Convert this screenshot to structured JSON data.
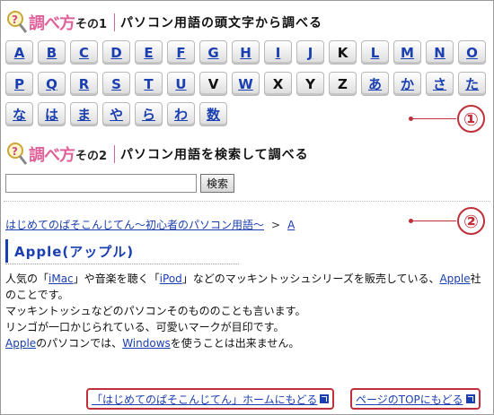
{
  "section1": {
    "title": "調べ方",
    "suffix": "その1",
    "desc": "パソコン用語の頭文字から調べる"
  },
  "section2": {
    "title": "調べ方",
    "suffix": "その2",
    "desc": "パソコン用語を検索して調べる"
  },
  "keys_row1": [
    {
      "label": "A",
      "linked": true
    },
    {
      "label": "B",
      "linked": true
    },
    {
      "label": "C",
      "linked": true
    },
    {
      "label": "D",
      "linked": true
    },
    {
      "label": "E",
      "linked": true
    },
    {
      "label": "F",
      "linked": true
    },
    {
      "label": "G",
      "linked": true
    },
    {
      "label": "H",
      "linked": true
    },
    {
      "label": "I",
      "linked": true
    },
    {
      "label": "J",
      "linked": true
    },
    {
      "label": "K",
      "linked": false
    },
    {
      "label": "L",
      "linked": true
    },
    {
      "label": "M",
      "linked": true
    },
    {
      "label": "N",
      "linked": true
    },
    {
      "label": "O",
      "linked": true
    }
  ],
  "keys_row2": [
    {
      "label": "P",
      "linked": true
    },
    {
      "label": "Q",
      "linked": true
    },
    {
      "label": "R",
      "linked": true
    },
    {
      "label": "S",
      "linked": true
    },
    {
      "label": "T",
      "linked": true
    },
    {
      "label": "U",
      "linked": true
    },
    {
      "label": "V",
      "linked": false
    },
    {
      "label": "W",
      "linked": true
    },
    {
      "label": "X",
      "linked": false
    },
    {
      "label": "Y",
      "linked": false
    },
    {
      "label": "Z",
      "linked": false
    },
    {
      "label": "あ",
      "linked": true
    },
    {
      "label": "か",
      "linked": true
    },
    {
      "label": "さ",
      "linked": true
    },
    {
      "label": "た",
      "linked": true
    }
  ],
  "keys_row3": [
    {
      "label": "な",
      "linked": true
    },
    {
      "label": "は",
      "linked": true
    },
    {
      "label": "ま",
      "linked": true
    },
    {
      "label": "や",
      "linked": true
    },
    {
      "label": "ら",
      "linked": true
    },
    {
      "label": "わ",
      "linked": true
    },
    {
      "label": "数",
      "linked": true
    }
  ],
  "search": {
    "value": "",
    "button_label": "検索"
  },
  "callouts": {
    "one": "①",
    "two": "②"
  },
  "breadcrumb": {
    "home": "はじめてのぱそこんじてん～初心者のパソコン用語～",
    "sep": ">",
    "current": "A"
  },
  "term": {
    "title": "Apple(アップル)"
  },
  "body": {
    "p1_pre": "人気の「",
    "p1_link1": "iMac",
    "p1_mid1": "」や音楽を聴く「",
    "p1_link2": "iPod",
    "p1_mid2": "」などのマッキントッシュシリーズを販売している、",
    "p1_link3": "Apple",
    "p1_post": "社のことです。",
    "p2": "マッキントッシュなどのパソコンそのもののことも言います。",
    "p3": "リンゴが一口かじられている、可愛いマークが目印です。",
    "p4_link1": "Apple",
    "p4_mid": "のパソコンでは、",
    "p4_link2": "Windows",
    "p4_post": "を使うことは出来ません。"
  },
  "footer": {
    "home_link": "「はじめてのぱそこんじてん」ホームにもどる",
    "top_link": "ページのTOPにもどる"
  },
  "colors": {
    "accent_red": "#c0303a",
    "link_blue": "#1a3fb0",
    "title_pink": "#e0609a"
  }
}
